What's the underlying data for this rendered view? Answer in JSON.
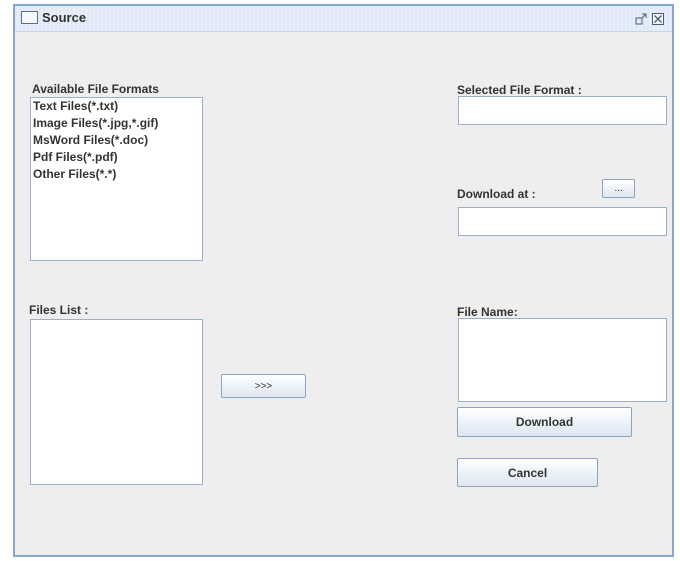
{
  "window": {
    "title": "Source",
    "controls": [
      "maximize-icon",
      "close-icon"
    ]
  },
  "formats": {
    "label": "Available File Formats",
    "items": [
      "Text Files(*.txt)",
      "Image Files(*.jpg,*.gif)",
      "MsWord Files(*.doc)",
      "Pdf Files(*.pdf)",
      "Other Files(*.*)"
    ]
  },
  "files": {
    "label": "Files List :",
    "items": []
  },
  "transfer_button": ">>>",
  "selected_format": {
    "label": "Selected File Format :",
    "value": ""
  },
  "download_at": {
    "label": "Download at :",
    "browse_label": "...",
    "value": ""
  },
  "file_name": {
    "label": "File Name:",
    "value": ""
  },
  "actions": {
    "download_label": "Download",
    "cancel_label": "Cancel"
  }
}
